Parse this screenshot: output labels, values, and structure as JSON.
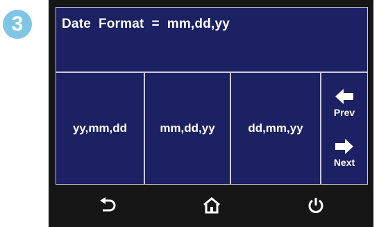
{
  "step_badge": "3",
  "screen": {
    "header": "Date  Format  =  mm,dd,yy",
    "options": [
      "yy,mm,dd",
      "mm,dd,yy",
      "dd,mm,yy"
    ],
    "nav": {
      "prev_label": "Prev",
      "next_label": "Next"
    }
  },
  "bottom_bar": {
    "icons": [
      "back-icon",
      "home-icon",
      "power-icon"
    ]
  },
  "colors": {
    "screen_bg": "#1c2163",
    "frame_bg": "#161616",
    "badge_bg": "#7fc6e6",
    "text": "#ffffff"
  }
}
